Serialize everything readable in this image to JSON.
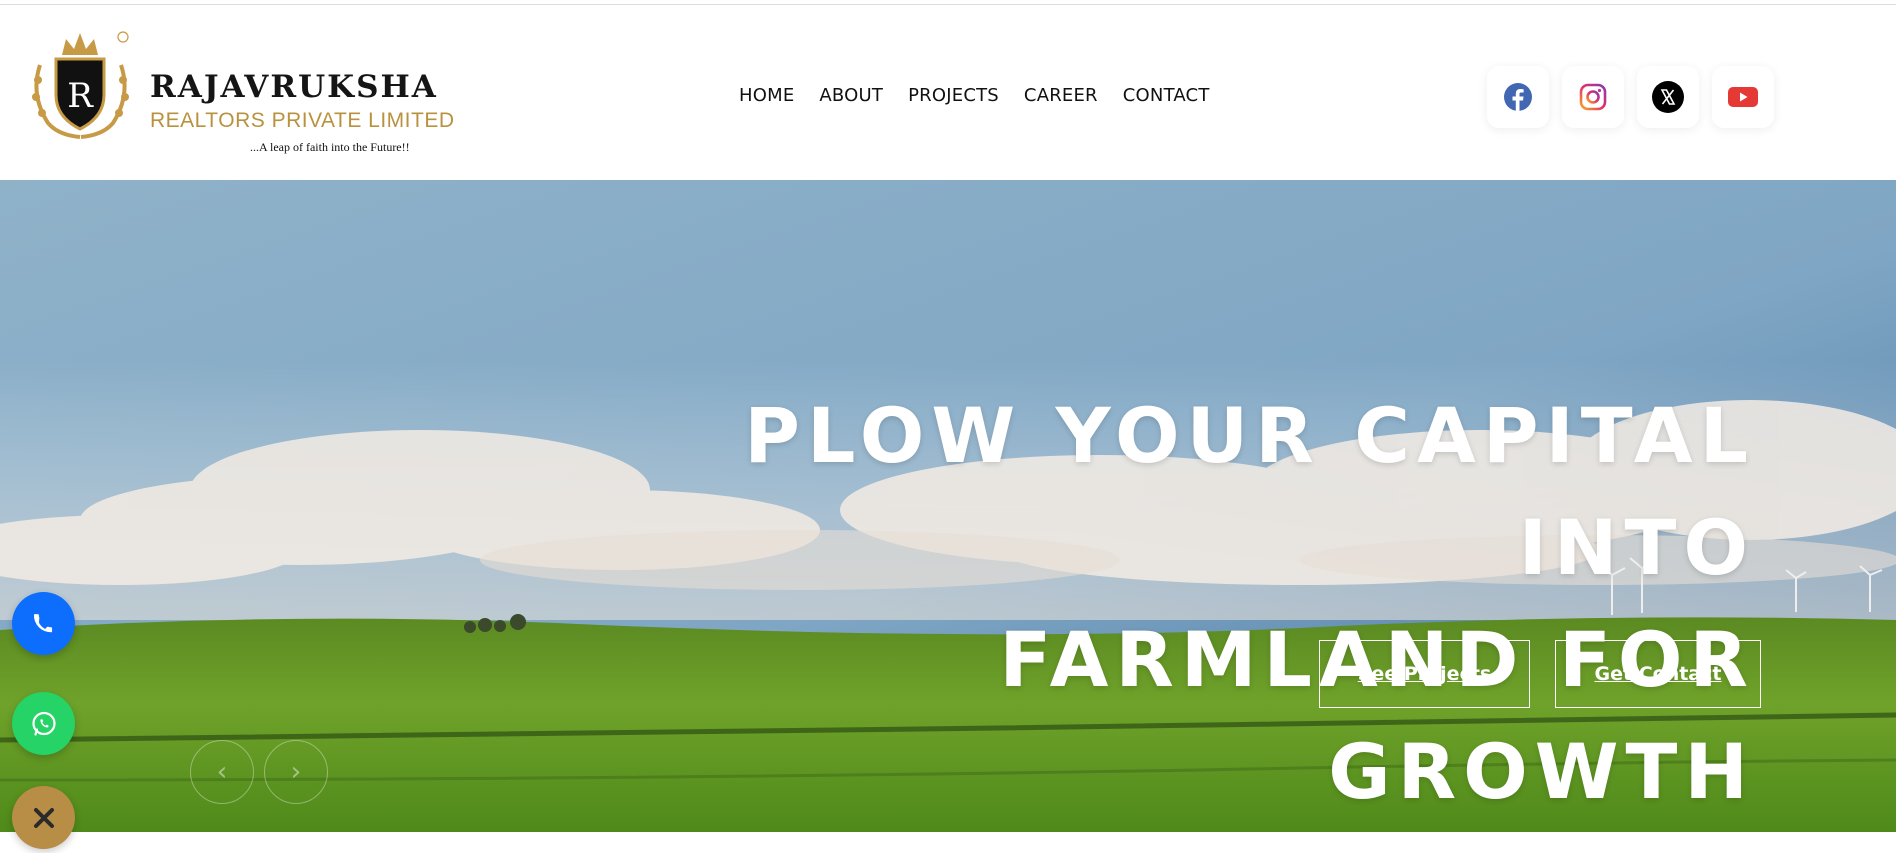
{
  "brand": {
    "name": "RAJAVRUKSHA",
    "subtitle": "REALTORS PRIVATE LIMITED",
    "tagline": "...A leap of faith into the Future!!",
    "emblem_letter": "R",
    "registered_mark": "®",
    "gold": "#b8923e"
  },
  "nav": {
    "items": [
      "HOME",
      "ABOUT",
      "PROJECTS",
      "CAREER",
      "CONTACT"
    ]
  },
  "socials": [
    {
      "icon": "facebook-icon",
      "color": "#3b5998"
    },
    {
      "icon": "instagram-icon",
      "color": "#e1306c"
    },
    {
      "icon": "x-twitter-icon",
      "color": "#000000"
    },
    {
      "icon": "youtube-icon",
      "color": "#e53935"
    }
  ],
  "hero": {
    "title_line1": "PLOW YOUR CAPITAL INTO",
    "title_line2": "FARMLAND FOR GROWTH",
    "cta_projects": "See Projects",
    "cta_contact": "Get Contact",
    "prev_icon": "chevron-left-icon",
    "next_icon": "chevron-right-icon"
  },
  "floating": {
    "phone_color": "#0d6efd",
    "whatsapp_color": "#25d366",
    "close_color": "#b88d45"
  }
}
